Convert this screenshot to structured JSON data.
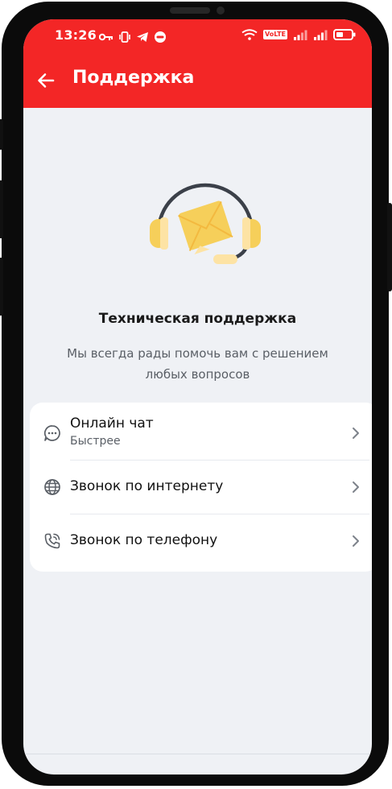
{
  "status_bar": {
    "time": "13:26",
    "volte": "VoLTE"
  },
  "app_bar": {
    "title": "Поддержка"
  },
  "hero": {
    "heading": "Техническая поддержка",
    "subtitle": "Мы всегда рады помочь вам с решением любых вопросов"
  },
  "support_options": [
    {
      "title": "Онлайн чат",
      "subtitle": "Быстрее",
      "icon": "chat-bubble-icon"
    },
    {
      "title": "Звонок по интернету",
      "icon": "globe-icon"
    },
    {
      "title": "Звонок по телефону",
      "icon": "phone-call-icon"
    }
  ],
  "colors": {
    "accent": "#f32626",
    "background": "#eff1f5",
    "card": "#ffffff",
    "illustration_yellow": "#f6cf5a"
  }
}
